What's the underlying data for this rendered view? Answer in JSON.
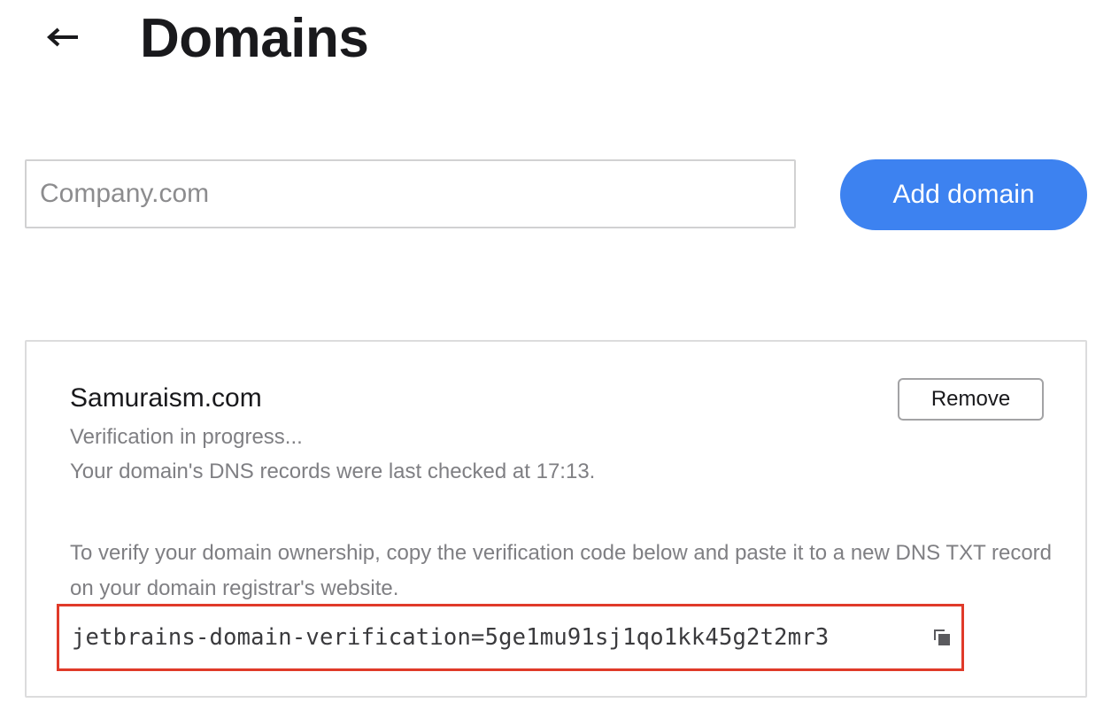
{
  "header": {
    "title": "Domains",
    "back_icon": "arrow-left-icon"
  },
  "add_form": {
    "placeholder": "Company.com",
    "value": "",
    "add_button_label": "Add domain",
    "accent_color": "#3d82f0"
  },
  "domains": [
    {
      "name": "Samuraism.com",
      "remove_label": "Remove",
      "status": "Verification in progress...",
      "last_checked": "Your domain's DNS records were last checked at 17:13.",
      "instructions": "To verify your domain ownership, copy the verification code below and paste it to a new DNS TXT record on your domain registrar's website.",
      "verification_code": "jetbrains-domain-verification=5ge1mu91sj1qo1kk45g2t2mr3",
      "copy_icon": "copy-icon",
      "highlight_color": "#e03a29"
    }
  ]
}
